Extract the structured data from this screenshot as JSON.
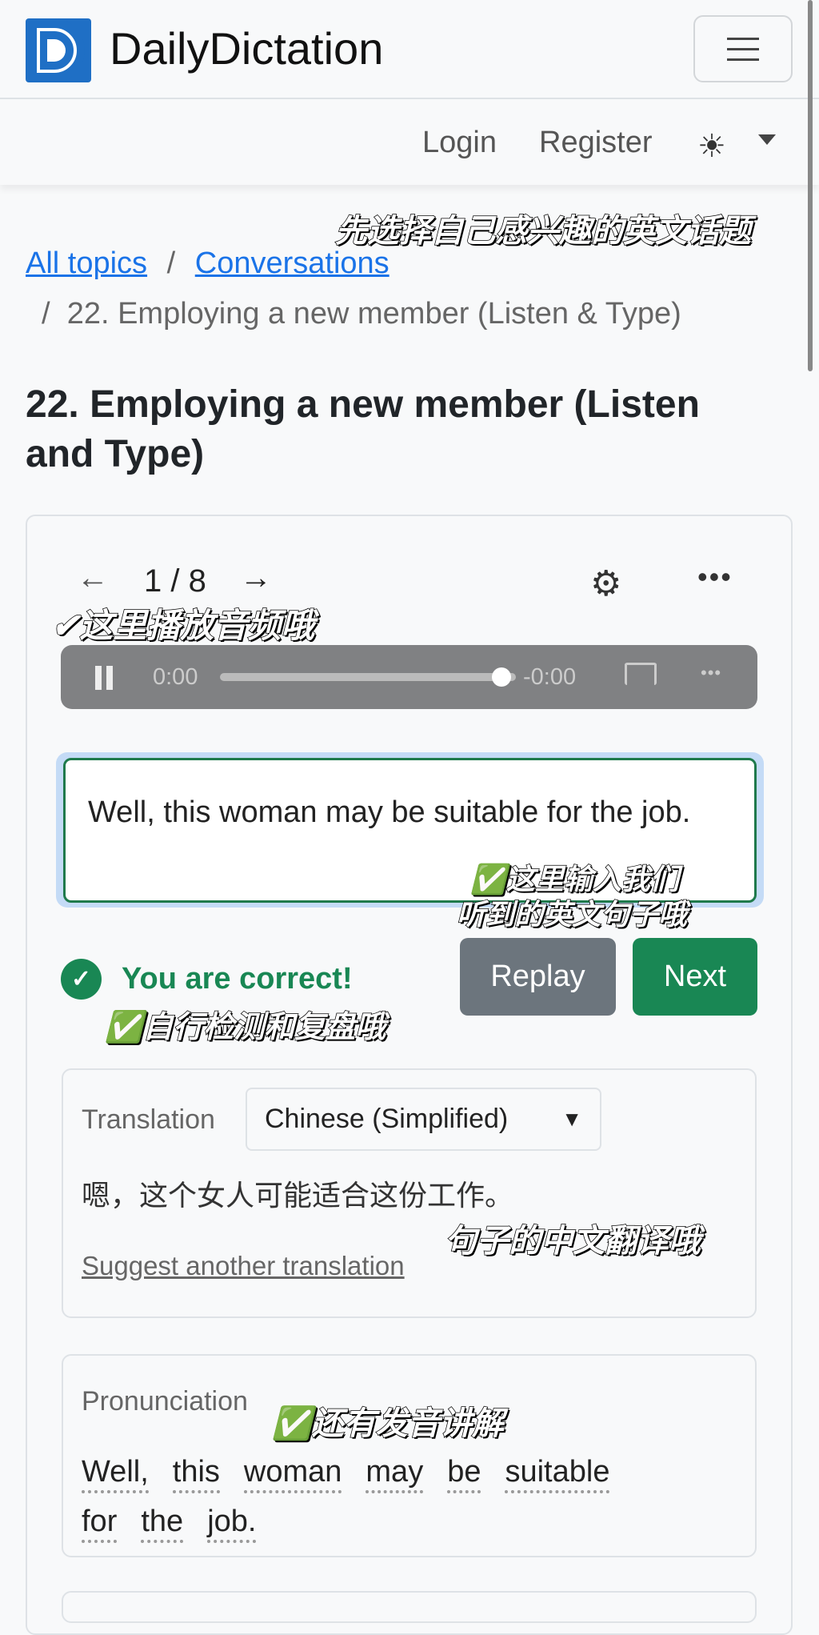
{
  "header": {
    "brand": "DailyDictation",
    "logo_letter": "D",
    "nav": {
      "login": "Login",
      "register": "Register",
      "theme_icon": "sun-icon"
    }
  },
  "breadcrumb": {
    "items": [
      "All topics",
      "Conversations"
    ],
    "separator": "/",
    "current": "22. Employing a new member (Listen & Type)"
  },
  "page_title": "22. Employing a new member (Listen and Type)",
  "exercise": {
    "prev": "←",
    "counter": "1 / 8",
    "next": "→",
    "player": {
      "current_time": "0:00",
      "remaining_time": "-0:00",
      "progress": 0.9
    },
    "answer": "Well, this woman may be suitable for the job.",
    "result": "You are correct!",
    "replay": "Replay",
    "next_button": "Next",
    "translation": {
      "label": "Translation",
      "language": "Chinese (Simplified)",
      "text": "嗯，这个女人可能适合这份工作。",
      "suggest": "Suggest another translation"
    },
    "pronunciation": {
      "label": "Pronunciation",
      "words": [
        "Well,",
        "this",
        "woman",
        "may",
        "be",
        "suitable",
        "for",
        "the",
        "job."
      ]
    }
  },
  "annotations": {
    "topic": "先选择自己感兴趣的英文话题",
    "audio": "✔这里播放音频哦",
    "input_1": "✅这里输入我们",
    "input_2": "听到的英文句子哦",
    "check": "✅自行检测和复盘哦",
    "translation": "句子的中文翻译哦",
    "pronunciation": "✅还有发音讲解"
  },
  "colors": {
    "brand": "#1f6fc5",
    "link": "#1a73e8",
    "success": "#198754",
    "secondary": "#6c757d"
  }
}
